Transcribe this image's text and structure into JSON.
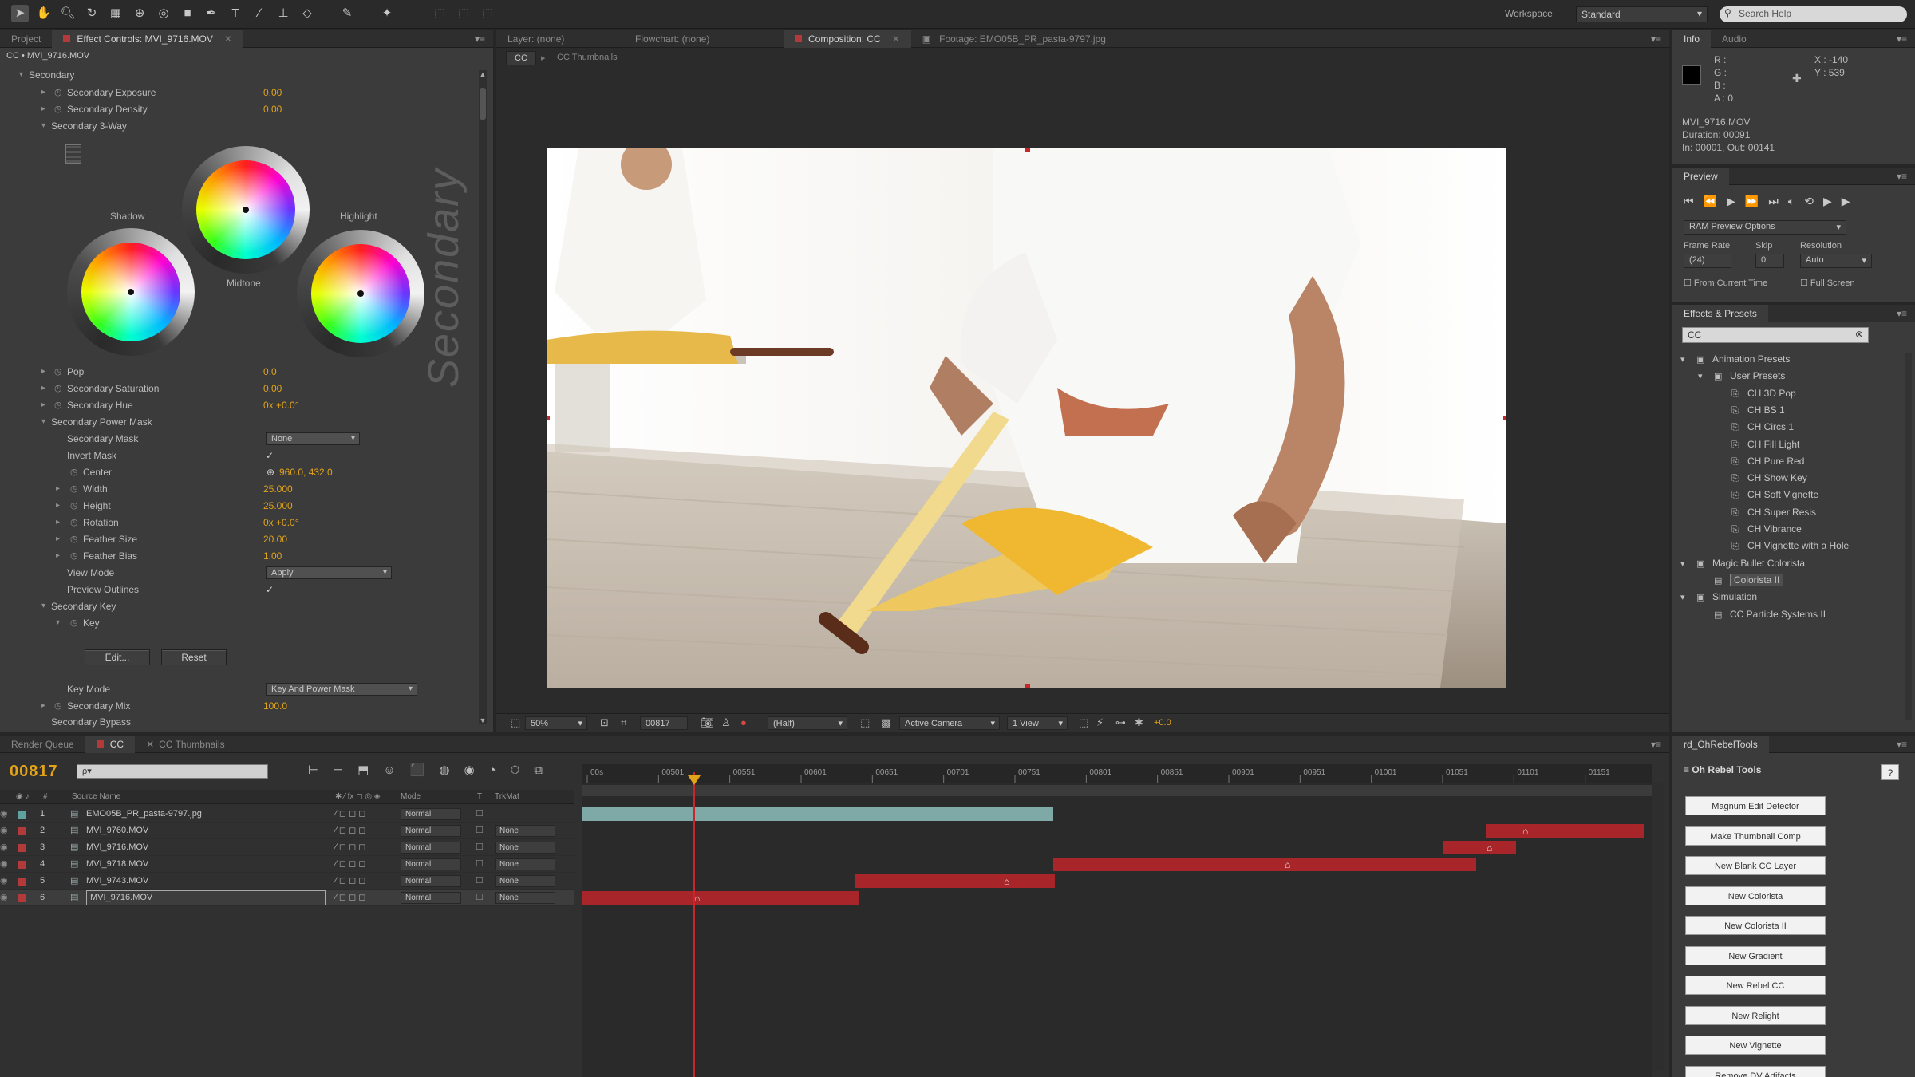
{
  "toolbar": {
    "tools": [
      "selection-icon",
      "hand-icon",
      "zoom-icon",
      "rotate-icon",
      "orbit-camera-icon",
      "unified-camera-icon",
      "pan-behind-icon",
      "rectangle-icon",
      "pen-icon",
      "type-icon",
      "brush-icon",
      "clone-stamp-icon",
      "eraser-icon",
      "roto-brush-icon",
      "puppet-pin-icon"
    ],
    "workspace_label": "Workspace",
    "workspace_value": "Standard",
    "search_placeholder": "Search Help"
  },
  "project_panel": {
    "tabs": [
      {
        "label": "Project"
      },
      {
        "label": "Effect Controls: MVI_9716.MOV"
      }
    ],
    "breadcrumb": "CC • MVI_9716.MOV",
    "section_title": "Secondary",
    "rows": [
      {
        "label": "Secondary Exposure",
        "value": "0.00"
      },
      {
        "label": "Secondary Density",
        "value": "0.00"
      },
      {
        "label": "Secondary 3-Way",
        "value": ""
      }
    ],
    "watermark": "Secondary",
    "wheels": {
      "shadow": "Shadow",
      "midtone": "Midtone",
      "highlight": "Highlight"
    },
    "rows2": [
      {
        "label": "Pop",
        "value": "0.0"
      },
      {
        "label": "Secondary Saturation",
        "value": "0.00"
      },
      {
        "label": "Secondary Hue",
        "value": "0x +0.0°"
      },
      {
        "label": "Secondary Power Mask",
        "value": ""
      },
      {
        "label": "Secondary Mask",
        "value": "None"
      },
      {
        "label": "Invert Mask",
        "value": "✓"
      },
      {
        "label": "Center",
        "value": "960.0, 432.0"
      },
      {
        "label": "Width",
        "value": "25.000"
      },
      {
        "label": "Height",
        "value": "25.000"
      },
      {
        "label": "Rotation",
        "value": "0x +0.0°"
      },
      {
        "label": "Feather Size",
        "value": "20.00"
      },
      {
        "label": "Feather Bias",
        "value": "1.00"
      },
      {
        "label": "View Mode",
        "value": "Apply"
      },
      {
        "label": "Preview Outlines",
        "value": "✓"
      },
      {
        "label": "Secondary Key",
        "value": ""
      },
      {
        "label": "Key",
        "value": ""
      }
    ],
    "edit_button": "Edit...",
    "reset_button": "Reset",
    "key_mode_label": "Key Mode",
    "key_mode_value": "Key And Power Mask",
    "secondary_mix_label": "Secondary Mix",
    "secondary_mix_value": "100.0",
    "bottom_row_label": "Secondary Bypass"
  },
  "viewer": {
    "tabs": [
      {
        "label": "Layer: (none)"
      },
      {
        "label": "Flowchart: (none)"
      },
      {
        "label": "Composition: CC"
      },
      {
        "label": "Footage: EMO05B_PR_pasta-9797.jpg"
      }
    ],
    "breadcrumb_root": "CC",
    "breadcrumb_child": "CC Thumbnails",
    "footer": {
      "zoom": "50%",
      "timecode": "00817",
      "resolution": "(Half)",
      "camera": "Active Camera",
      "views": "1 View",
      "exposure": "+0.0"
    }
  },
  "info_panel": {
    "tabs": [
      {
        "label": "Info"
      },
      {
        "label": "Audio"
      }
    ],
    "r": "R :",
    "g": "G :",
    "b": "B :",
    "a": "A : 0",
    "x": "X : -140",
    "y": "Y : 539",
    "clip_name": "MVI_9716.MOV",
    "duration": "Duration: 00091",
    "in_out": "In: 00001, Out: 00141"
  },
  "preview_panel": {
    "title": "Preview",
    "ram_options": "RAM Preview Options",
    "frame_rate_label": "Frame Rate",
    "skip_label": "Skip",
    "resolution_label": "Resolution",
    "frame_rate_value": "(24)",
    "skip_value": "0",
    "resolution_value": "Auto",
    "from_current": "From Current Time",
    "full_screen": "Full Screen"
  },
  "effects_panel": {
    "title": "Effects & Presets",
    "search_value": "CC",
    "items": [
      {
        "label": "Animation Presets",
        "level": 0,
        "icon": "folder"
      },
      {
        "label": "User Presets",
        "level": 1,
        "icon": "folder"
      },
      {
        "label": "CH 3D Pop",
        "level": 2,
        "icon": "preset"
      },
      {
        "label": "CH BS 1",
        "level": 2,
        "icon": "preset"
      },
      {
        "label": "CH Circs 1",
        "level": 2,
        "icon": "preset"
      },
      {
        "label": "CH Fill Light",
        "level": 2,
        "icon": "preset"
      },
      {
        "label": "CH Pure Red",
        "level": 2,
        "icon": "preset"
      },
      {
        "label": "CH Show Key",
        "level": 2,
        "icon": "preset"
      },
      {
        "label": "CH Soft Vignette",
        "level": 2,
        "icon": "preset"
      },
      {
        "label": "CH Super Resis",
        "level": 2,
        "icon": "preset"
      },
      {
        "label": "CH Vibrance",
        "level": 2,
        "icon": "preset"
      },
      {
        "label": "CH Vignette with a Hole",
        "level": 2,
        "icon": "preset"
      },
      {
        "label": "Magic Bullet Colorista",
        "level": 0,
        "icon": "folder"
      },
      {
        "label": "Colorista II",
        "level": 1,
        "icon": "effect",
        "selected": true
      },
      {
        "label": "Simulation",
        "level": 0,
        "icon": "folder"
      },
      {
        "label": "CC Particle Systems II",
        "level": 1,
        "icon": "effect"
      }
    ]
  },
  "rebel_panel": {
    "tab": "rd_OhRebelTools",
    "title": "Oh Rebel Tools",
    "help": "?",
    "buttons": [
      "Magnum Edit Detector",
      "Make Thumbnail Comp",
      "New Blank CC Layer",
      "New Colorista",
      "New Colorista II",
      "New Gradient",
      "New Rebel CC",
      "New Relight",
      "New Vignette",
      "Remove DV Artifacts"
    ]
  },
  "timeline": {
    "tabs": [
      {
        "label": "Render Queue"
      },
      {
        "label": "CC"
      },
      {
        "label": "CC Thumbnails"
      }
    ],
    "current_time": "00817",
    "search_placeholder": "ρ▾",
    "headers": {
      "num": "#",
      "name": "Source Name",
      "mode": "Mode",
      "t": "T",
      "trkmat": "TrkMat"
    },
    "ruler": [
      "00s",
      "00501",
      "00551",
      "00601",
      "00651",
      "00701",
      "00751",
      "00801",
      "00851",
      "00901",
      "00951",
      "01001",
      "01051",
      "01101",
      "01151"
    ],
    "layers": [
      {
        "num": "1",
        "name": "EMO05B_PR_pasta-9797.jpg",
        "mode": "Normal",
        "trkmat": "",
        "color": "#5fa0a0"
      },
      {
        "num": "2",
        "name": "MVI_9760.MOV",
        "mode": "Normal",
        "trkmat": "None",
        "color": "#b33a3a"
      },
      {
        "num": "3",
        "name": "MVI_9716.MOV",
        "mode": "Normal",
        "trkmat": "None",
        "color": "#b33a3a"
      },
      {
        "num": "4",
        "name": "MVI_9718.MOV",
        "mode": "Normal",
        "trkmat": "None",
        "color": "#b33a3a"
      },
      {
        "num": "5",
        "name": "MVI_9743.MOV",
        "mode": "Normal",
        "trkmat": "None",
        "color": "#b33a3a"
      },
      {
        "num": "6",
        "name": "MVI_9716.MOV",
        "mode": "Normal",
        "trkmat": "None",
        "color": "#b33a3a"
      }
    ]
  },
  "colors": {
    "accent_orange": "#e2a319",
    "clip_red": "#a8262a",
    "clip_teal": "#7ea9a7",
    "playhead": "#c8262a"
  }
}
